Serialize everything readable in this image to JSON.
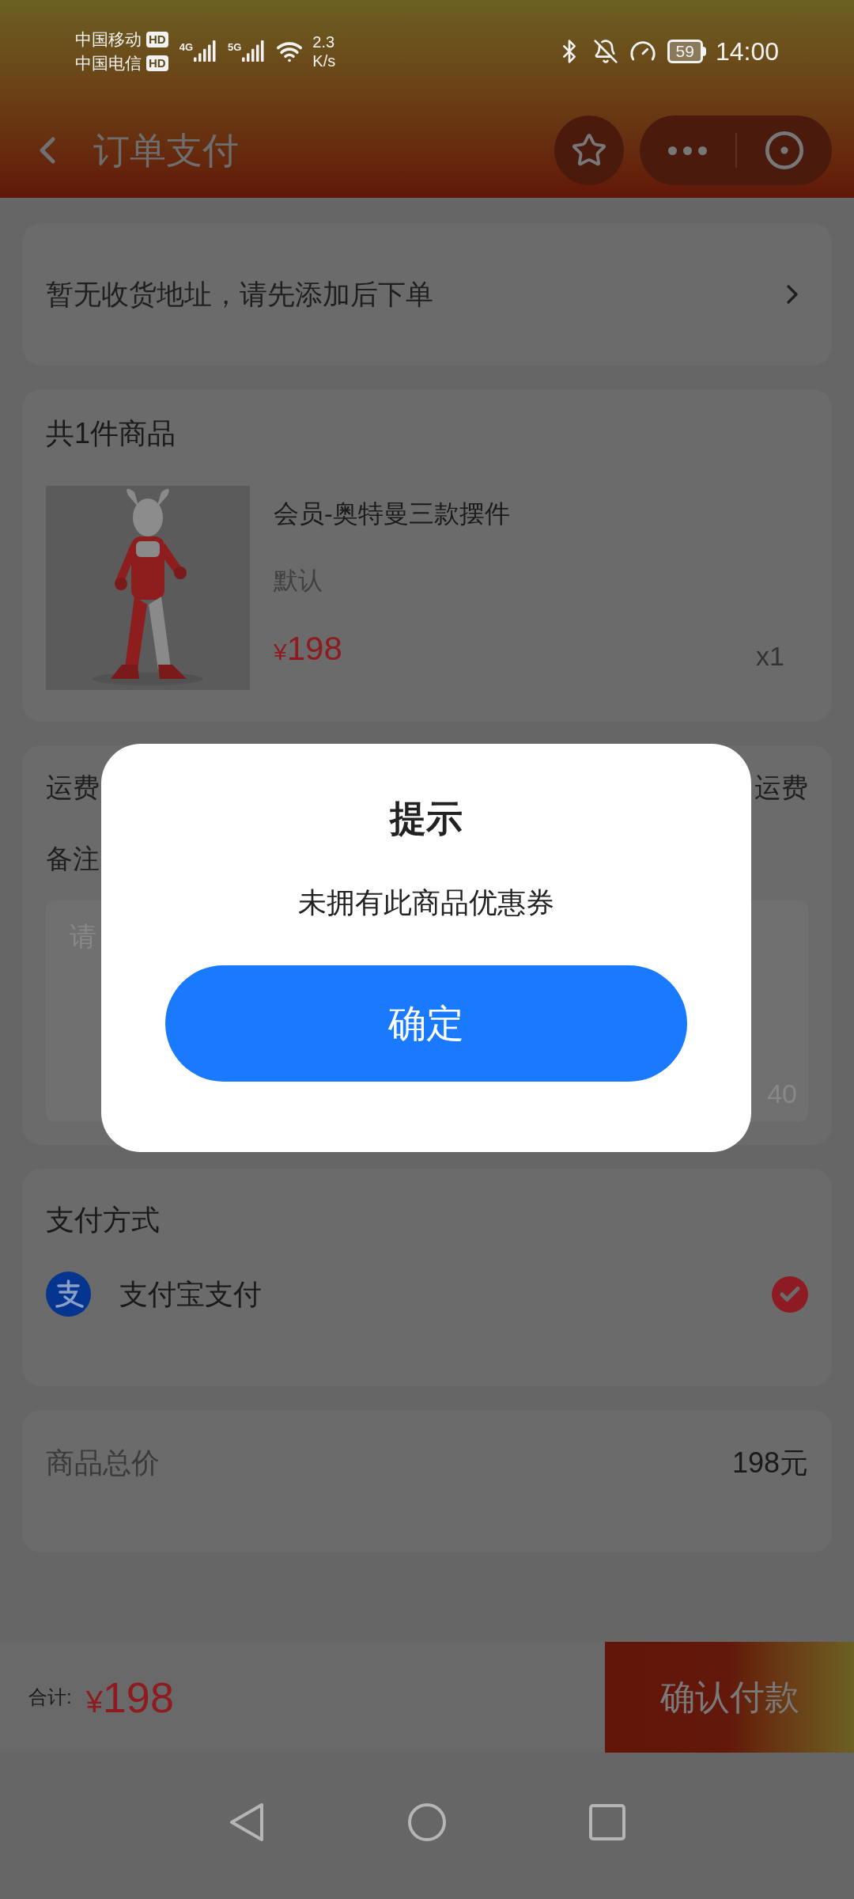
{
  "status_bar": {
    "carriers": [
      {
        "name": "中国移动",
        "badge": "HD"
      },
      {
        "name": "中国电信",
        "badge": "HD"
      }
    ],
    "networks": [
      "4G",
      "5G"
    ],
    "speed": [
      "2.3",
      "K/s"
    ],
    "battery": "59",
    "time": "14:00"
  },
  "header": {
    "title": "订单支付"
  },
  "address": {
    "text": "暂无收货地址，请先添加后下单"
  },
  "goods": {
    "title": "共1件商品",
    "item": {
      "name": "会员-奥特曼三款摆件",
      "spec": "默认",
      "currency": "¥",
      "price": "198",
      "quantity": "x1"
    }
  },
  "extras": {
    "shipping_label": "运费",
    "shipping_value": "运费",
    "remark_label": "备注",
    "remark_placeholder": "请",
    "remark_counter": "40"
  },
  "payment": {
    "title": "支付方式",
    "methods": [
      {
        "name": "支付宝支付",
        "selected": true
      }
    ]
  },
  "total": {
    "label": "商品总价",
    "value": "198元"
  },
  "footer": {
    "label": "合计:",
    "currency": "¥",
    "amount": "198",
    "button": "确认付款"
  },
  "dialog": {
    "title": "提示",
    "message": "未拥有此商品优惠券",
    "button": "确定"
  }
}
